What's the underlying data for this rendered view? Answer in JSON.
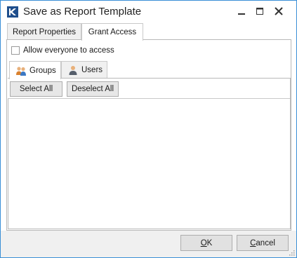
{
  "window": {
    "title": "Save as Report Template"
  },
  "tabs": [
    {
      "label": "Report Properties",
      "active": false
    },
    {
      "label": "Grant Access",
      "active": true
    }
  ],
  "grant_access": {
    "allow_everyone": {
      "label": "Allow everyone to access",
      "checked": false
    },
    "subtabs": [
      {
        "label": "Groups",
        "icon": "group-icon",
        "active": true
      },
      {
        "label": "Users",
        "icon": "user-icon",
        "active": false
      }
    ],
    "toolbar": {
      "select_all": "Select All",
      "deselect_all": "Deselect All"
    }
  },
  "buttons": {
    "ok_mnemonic": "O",
    "ok_rest": "K",
    "cancel_mnemonic": "C",
    "cancel_rest": "ancel"
  },
  "colors": {
    "window_border": "#3a8fd6",
    "panel_border": "#b9b9b9",
    "dialog_bg": "#f0f0f0"
  }
}
